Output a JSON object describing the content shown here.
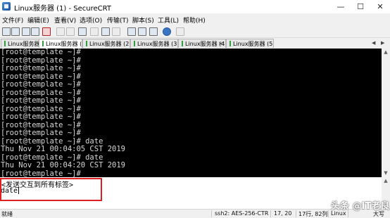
{
  "window": {
    "title": "Linux服务器 (1) - SecureCRT"
  },
  "menu": [
    "文件(F)",
    "编辑(E)",
    "查看(V)",
    "选项(O)",
    "传输(T)",
    "脚本(S)",
    "工具(L)",
    "帮助(H)"
  ],
  "tabs": [
    {
      "label": "Linux服务器"
    },
    {
      "label": "Linux服务器 (1)",
      "active": true
    },
    {
      "label": "Linux服务器 (2)"
    },
    {
      "label": "Linux服务器 (3)"
    },
    {
      "label": "Linux服务器 (4)"
    },
    {
      "label": "Linux服务器 (5)"
    }
  ],
  "terminal": {
    "lines": [
      "[root@template ~]#",
      "[root@template ~]#",
      "[root@template ~]#",
      "[root@template ~]#",
      "[root@template ~]#",
      "[root@template ~]#",
      "[root@template ~]#",
      "[root@template ~]#",
      "[root@template ~]#",
      "[root@template ~]#",
      "[root@template ~]#",
      "[root@template ~]# date",
      "Thu Nov 21 00:04:05 CST 2019",
      "[root@template ~]# date",
      "Thu Nov 21 00:04:20 CST 2019",
      "[root@template ~]#"
    ]
  },
  "chat": {
    "placeholder": "<发送交互到所有标签>",
    "value": "date"
  },
  "status": {
    "ready": "就绪",
    "cipher": "ssh2: AES-256-CTR",
    "cursor": "17, 20",
    "size": "17行, 82列",
    "os": "Linux",
    "caps": "大写"
  },
  "watermark": "头条 @IT老良"
}
